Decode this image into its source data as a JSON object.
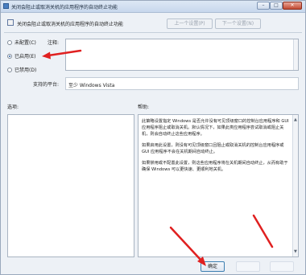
{
  "window": {
    "title": "关闭会阻止或取消关机的应用程序的自动终止功能",
    "min_glyph": "–",
    "max_glyph": "□",
    "close_glyph": "✕"
  },
  "header": {
    "heading": "关闭会阻止或取消关机的应用程序的自动终止功能",
    "prev_label": "上一个设置(P)",
    "next_label": "下一个设置(N)"
  },
  "state": {
    "options": [
      {
        "label": "未配置(C)",
        "selected": false
      },
      {
        "label": "已启用(E)",
        "selected": true
      },
      {
        "label": "已禁用(D)",
        "selected": false
      }
    ]
  },
  "comment": {
    "label": "注释:",
    "value": ""
  },
  "supported": {
    "label": "支持的平台:",
    "value": "至少 Windows Vista"
  },
  "panes": {
    "options_label": "选项:",
    "help_label": "帮助:"
  },
  "help": {
    "paragraphs": [
      "此策略设置指定 Windows 是否允许没有可见顶级窗口的控制台应用程序和 GUI 应用程序阻止或取消关机。默认情况下，如果此类应用程序尝试取消或阻止关机，则会自动终止这些应用程序。",
      "如果启用此设置，则没有可见顶级窗口且阻止或取消关机的控制台应用程序或 GUI 应用程序不会在关机期间自动终止。",
      "如果禁用或不配置此设置，则这些应用程序将在关机期间自动终止，从而有助于确保 Windows 可以更快速、更顺利地关机。"
    ]
  },
  "footer": {
    "ok_label": "确定"
  },
  "colors": {
    "annotation_arrow": "#e02020",
    "accent": "#2b5fa3"
  }
}
